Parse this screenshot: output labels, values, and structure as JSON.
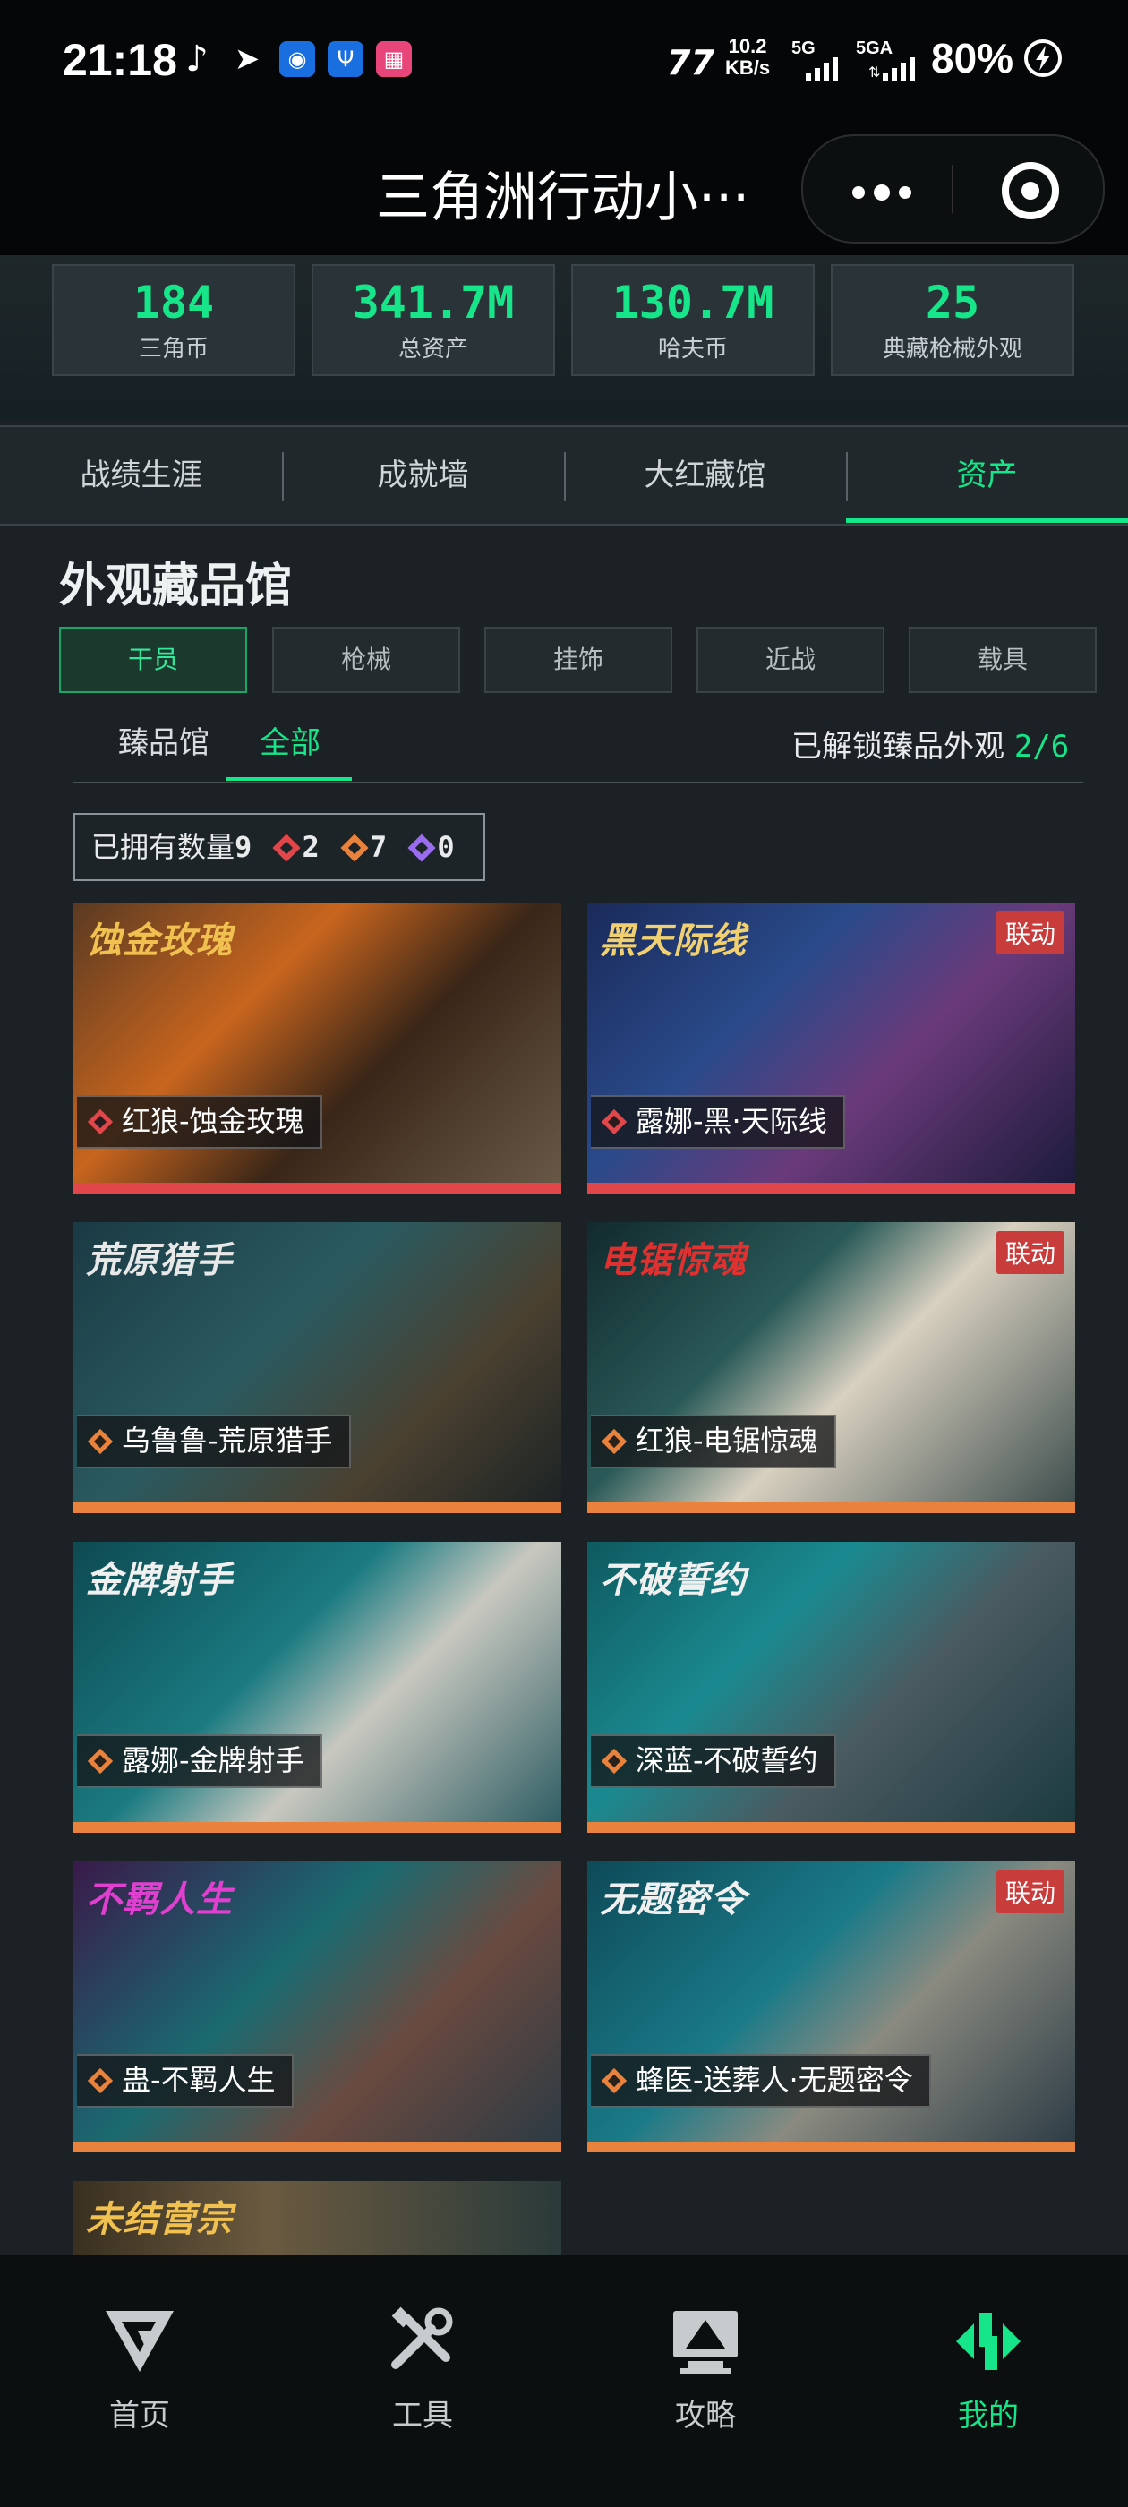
{
  "status": {
    "time": "21:18",
    "net_speed": "10.2",
    "net_unit": "KB/s",
    "sig1": "5G",
    "sig2": "5GA",
    "battery": "80%"
  },
  "nav": {
    "title": "三角洲行动小···"
  },
  "stats": [
    {
      "value": "184",
      "label": "三角币"
    },
    {
      "value": "341.7M",
      "label": "总资产"
    },
    {
      "value": "130.7M",
      "label": "哈夫币"
    },
    {
      "value": "25",
      "label": "典藏枪械外观"
    }
  ],
  "tabs": [
    "战绩生涯",
    "成就墙",
    "大红藏馆",
    "资产"
  ],
  "section": {
    "title": "外观藏品馆",
    "categories": [
      "干员",
      "枪械",
      "挂饰",
      "近战",
      "载具"
    ],
    "subtabs": [
      "臻品馆",
      "全部"
    ],
    "unlock_label": "已解锁臻品外观",
    "unlock_count": "2/6",
    "owned_label": "已拥有数量",
    "owned_total": "9",
    "owned_counts": [
      "2",
      "7",
      "0"
    ]
  },
  "cards": [
    {
      "name": "红狼-蚀金玫瑰",
      "logo": "蚀金玫瑰",
      "badge": ""
    },
    {
      "name": "露娜-黑·天际线",
      "logo": "黑天际线",
      "badge": "联动"
    },
    {
      "name": "乌鲁鲁-荒原猎手",
      "logo": "荒原猎手",
      "badge": ""
    },
    {
      "name": "红狼-电锯惊魂",
      "logo": "电锯惊魂",
      "badge": "联动"
    },
    {
      "name": "露娜-金牌射手",
      "logo": "金牌射手",
      "badge": ""
    },
    {
      "name": "深蓝-不破誓约",
      "logo": "不破誓约",
      "badge": ""
    },
    {
      "name": "蛊-不羁人生",
      "logo": "不羁人生",
      "badge": ""
    },
    {
      "name": "蜂医-送葬人·无题密令",
      "logo": "无题密令",
      "badge": "联动"
    },
    {
      "name": "",
      "logo": "未结营宗",
      "badge": ""
    }
  ],
  "bottom_tabs": [
    "首页",
    "工具",
    "攻略",
    "我的"
  ],
  "colors": {
    "accent": "#17e58a",
    "red_rarity": "#e0464a",
    "orange_rarity": "#e8823c",
    "purple_rarity": "#9a6cf0",
    "badge": "#c93c3c"
  }
}
